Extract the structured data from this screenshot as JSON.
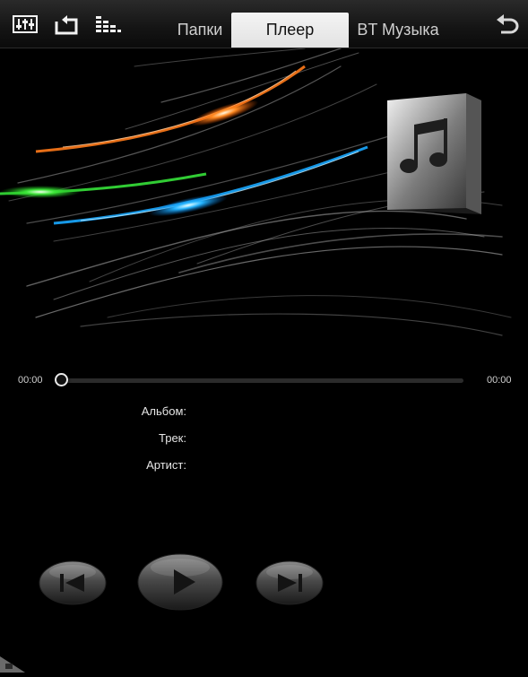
{
  "toolbar": {
    "icons": [
      "equalizer-icon",
      "repeat-icon",
      "playlist-icon",
      "back-icon"
    ]
  },
  "tabs": [
    {
      "label": "Папки",
      "active": false
    },
    {
      "label": "Плеер",
      "active": true
    },
    {
      "label": "BT Музыка",
      "active": false
    }
  ],
  "progress": {
    "elapsed": "00:00",
    "total": "00:00",
    "fraction": 0
  },
  "info": {
    "album_label": "Альбом:",
    "album_value": "",
    "track_label": "Трек:",
    "track_value": "",
    "artist_label": "Артист:",
    "artist_value": ""
  },
  "controls": {
    "icons": [
      "previous-track-icon",
      "play-icon",
      "next-track-icon"
    ]
  },
  "colors": {
    "background": "#000000",
    "active_tab_bg": "#eeeeee",
    "streak_orange": "#ff7a1a",
    "streak_green": "#36e23a",
    "streak_blue": "#1aa8ff"
  }
}
